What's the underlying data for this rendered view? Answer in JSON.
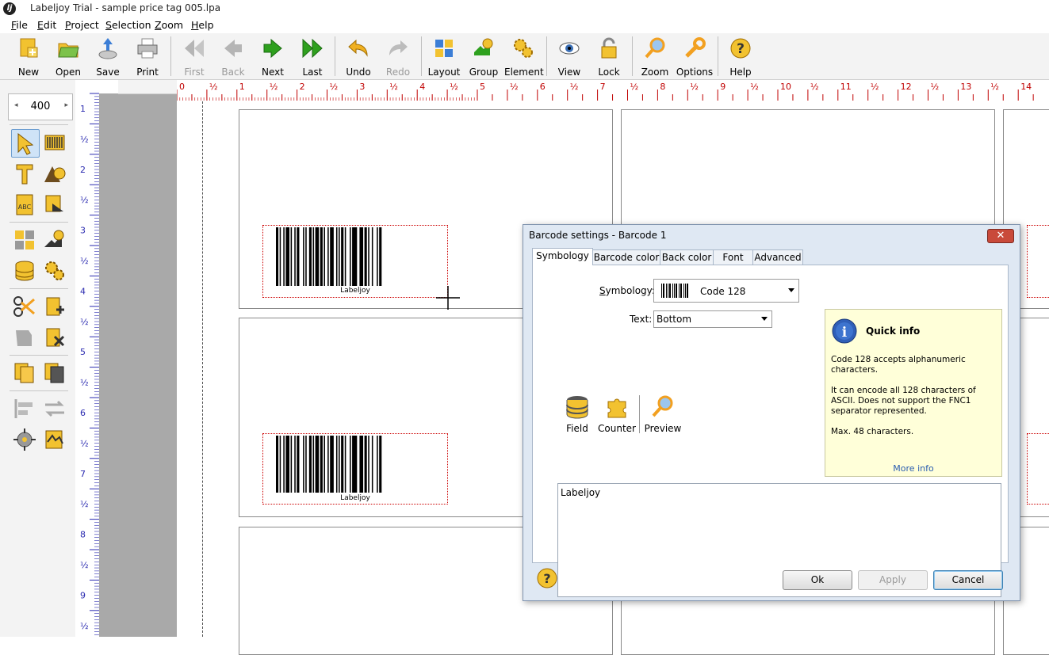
{
  "window": {
    "title": "Labeljoy Trial - sample price tag 005.lpa"
  },
  "menu": [
    {
      "label": "File",
      "key": "F"
    },
    {
      "label": "Edit",
      "key": "E"
    },
    {
      "label": "Project",
      "key": "P"
    },
    {
      "label": "Selection",
      "key": "S"
    },
    {
      "label": "Zoom",
      "key": "Z"
    },
    {
      "label": "Help",
      "key": "H"
    }
  ],
  "toolbar": {
    "new": "New",
    "open": "Open",
    "save": "Save",
    "print": "Print",
    "first": "First",
    "back": "Back",
    "next": "Next",
    "last": "Last",
    "undo": "Undo",
    "redo": "Redo",
    "layout": "Layout",
    "group": "Group",
    "element": "Element",
    "view": "View",
    "lock": "Lock",
    "zoom": "Zoom",
    "options": "Options",
    "help": "Help"
  },
  "zoom_level": "400",
  "ruler": {
    "h_labels": [
      "0",
      "½",
      "1",
      "½",
      "2",
      "½",
      "3",
      "½",
      "4",
      "½",
      "5",
      "½",
      "6",
      "½",
      "7",
      "½",
      "8",
      "½",
      "9",
      "½",
      "10",
      "½",
      "11",
      "½",
      "12",
      "½",
      "13",
      "½",
      "14"
    ],
    "v_labels": [
      "1",
      "½",
      "2",
      "½",
      "3",
      "½",
      "4",
      "½",
      "5",
      "½",
      "6",
      "½",
      "7",
      "½",
      "8",
      "½",
      "9",
      "½"
    ]
  },
  "canvas": {
    "barcode_caption": "Labeljoy"
  },
  "dialog": {
    "title": "Barcode settings - Barcode 1",
    "close_glyph": "✕",
    "tabs": [
      "Symbology",
      "Barcode color",
      "Back color",
      "Font",
      "Advanced"
    ],
    "symbology_label": "Symbology:",
    "symbology_value": "Code 128",
    "text_label": "Text:",
    "text_value": "Bottom",
    "quick_info": {
      "title": "Quick info",
      "text1": "Code 128 accepts alphanumeric characters.",
      "text2": "It can encode all 128 characters of ASCII. Does not support the FNC1 separator represented.",
      "text3": "Max. 48 characters.",
      "more": "More info"
    },
    "buttons_small": {
      "field": "Field",
      "counter": "Counter",
      "preview": "Preview"
    },
    "text_content": "Labeljoy",
    "ok": "Ok",
    "apply": "Apply",
    "cancel": "Cancel"
  }
}
